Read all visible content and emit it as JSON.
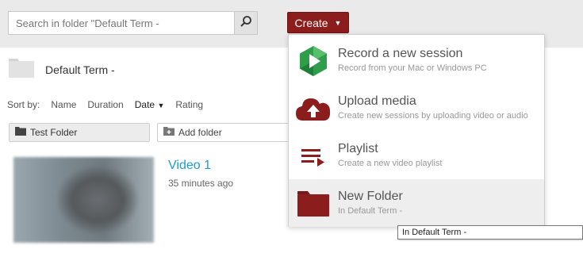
{
  "search": {
    "placeholder": "Search in folder \"Default Term -"
  },
  "create": {
    "label": "Create",
    "caret": "▼"
  },
  "folder": {
    "title": "Default Term -"
  },
  "sort": {
    "label": "Sort by:",
    "options": [
      "Name",
      "Duration",
      "Date",
      "Rating"
    ],
    "active": "Date",
    "direction": "▼"
  },
  "folders": {
    "test_folder": "Test Folder",
    "add_folder": "Add folder"
  },
  "video": {
    "title": "Video 1",
    "time": "35 minutes ago"
  },
  "menu": {
    "items": [
      {
        "title": "Record a new session",
        "subtitle": "Record from your Mac or Windows PC",
        "icon": "panopto-record-icon"
      },
      {
        "title": "Upload media",
        "subtitle": "Create new sessions by uploading video or audio",
        "icon": "cloud-upload-icon"
      },
      {
        "title": "Playlist",
        "subtitle": "Create a new video playlist",
        "icon": "playlist-icon"
      },
      {
        "title": "New Folder",
        "subtitle": "In Default Term -",
        "icon": "folder-icon"
      }
    ]
  },
  "tooltip": {
    "text": "In Default Term -"
  },
  "colors": {
    "brand": "#8c1d1d",
    "link": "#1a9cd6",
    "topbar": "#eaeaea"
  }
}
